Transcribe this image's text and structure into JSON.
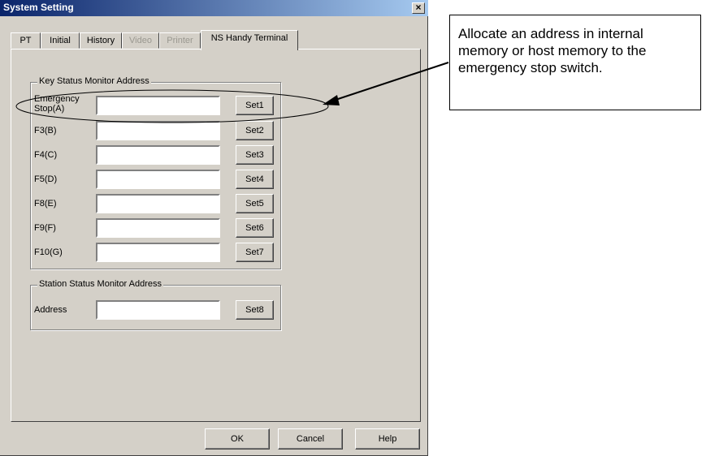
{
  "window": {
    "title": "System Setting",
    "close_label": "×"
  },
  "tabs": [
    {
      "label": "PT",
      "state": "normal"
    },
    {
      "label": "Initial",
      "state": "normal"
    },
    {
      "label": "History",
      "state": "normal"
    },
    {
      "label": "Video",
      "state": "disabled"
    },
    {
      "label": "Printer",
      "state": "disabled"
    },
    {
      "label": "NS Handy Terminal",
      "state": "active"
    }
  ],
  "key_status_group": {
    "title": "Key Status Monitor Address",
    "rows": [
      {
        "label": "Emergency",
        "label2": "Stop(A)",
        "value": "",
        "button": "Set1"
      },
      {
        "label": "F3(B)",
        "value": "",
        "button": "Set2"
      },
      {
        "label": "F4(C)",
        "value": "",
        "button": "Set3"
      },
      {
        "label": "F5(D)",
        "value": "",
        "button": "Set4"
      },
      {
        "label": "F8(E)",
        "value": "",
        "button": "Set5"
      },
      {
        "label": "F9(F)",
        "value": "",
        "button": "Set6"
      },
      {
        "label": "F10(G)",
        "value": "",
        "button": "Set7"
      }
    ]
  },
  "station_status_group": {
    "title": "Station Status Monitor Address",
    "rows": [
      {
        "label": "Address",
        "value": "",
        "button": "Set8"
      }
    ]
  },
  "footer": {
    "ok": "OK",
    "cancel": "Cancel",
    "help": "Help"
  },
  "callout": {
    "text": "Allocate an address in internal memory or host memory to the emergency stop switch."
  }
}
